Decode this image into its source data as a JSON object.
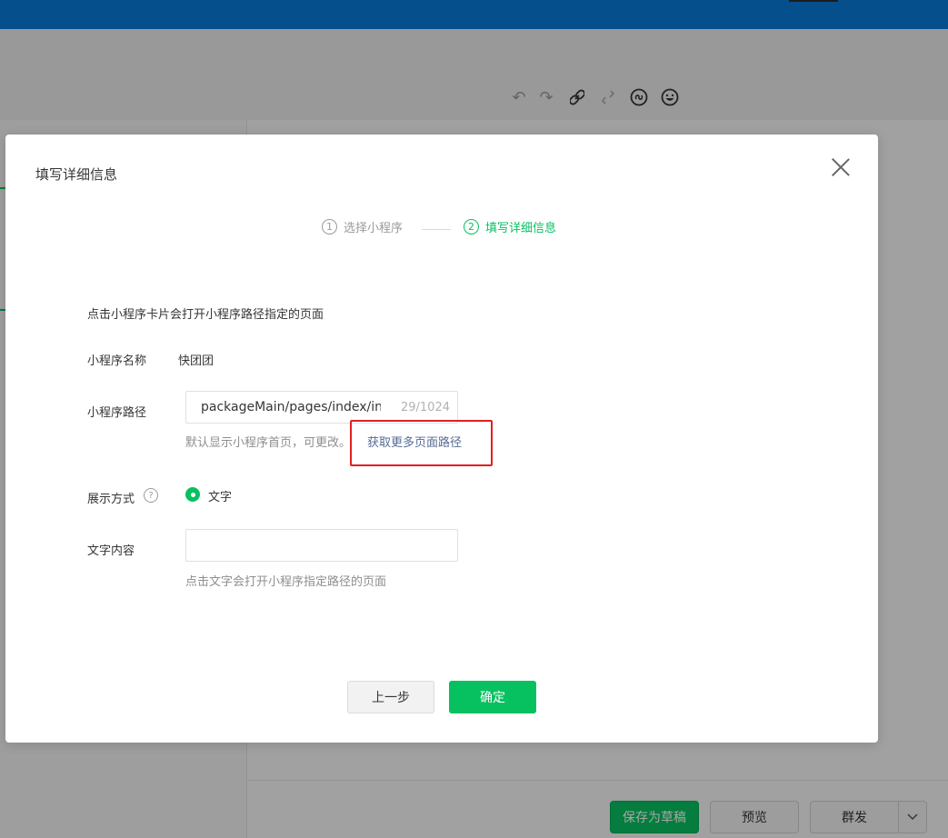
{
  "dialog": {
    "title": "填写详细信息",
    "steps": [
      {
        "num": "1",
        "label": "选择小程序"
      },
      {
        "num": "2",
        "label": "填写详细信息"
      }
    ],
    "description": "点击小程序卡片会打开小程序路径指定的页面",
    "name_label": "小程序名称",
    "name_value": "快团团",
    "path_label": "小程序路径",
    "path_value": "packageMain/pages/index/index",
    "path_count": "29/1024",
    "path_hint": "默认显示小程序首页，可更改。",
    "path_link": "获取更多页面路径",
    "display_label": "展示方式",
    "help_glyph": "?",
    "display_option": "文字",
    "text_label": "文字内容",
    "text_value": "",
    "text_hint": "点击文字会打开小程序指定路径的页面",
    "prev_button": "上一步",
    "ok_button": "确定"
  },
  "bottom_bar": {
    "save_draft": "保存为草稿",
    "preview": "预览",
    "mass_send": "群发"
  },
  "colors": {
    "accent": "#07c160",
    "link": "#576b95",
    "topbar": "#0a7ad9",
    "highlight": "#e02020"
  },
  "toolbar_icons": [
    "undo-icon",
    "redo-icon",
    "link-icon",
    "unlink-icon",
    "miniprogram-icon",
    "emoji-icon"
  ]
}
